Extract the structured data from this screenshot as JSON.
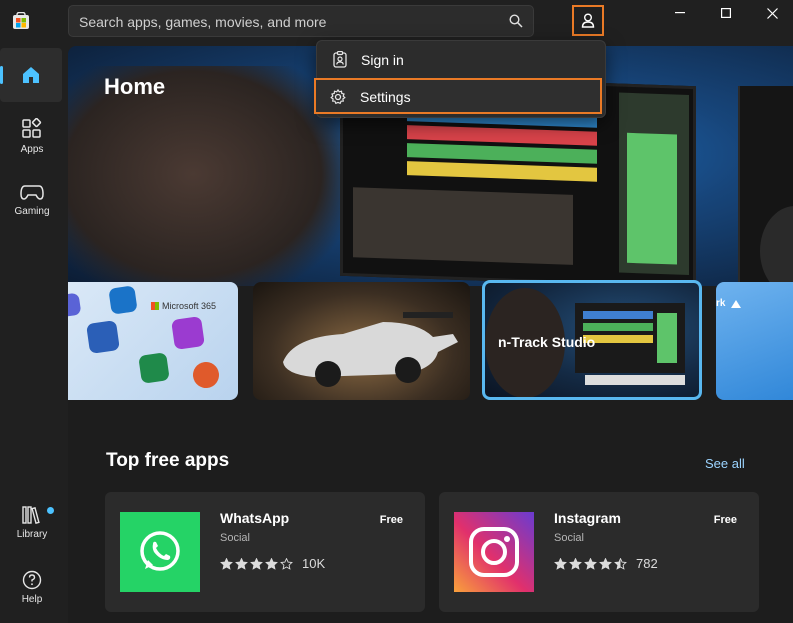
{
  "search": {
    "placeholder": "Search apps, games, movies, and more"
  },
  "sidebar": {
    "items": [
      {
        "label": ""
      },
      {
        "label": "Apps"
      },
      {
        "label": "Gaming"
      },
      {
        "label": "Library"
      },
      {
        "label": "Help"
      }
    ]
  },
  "hero": {
    "title": "Home"
  },
  "carousel": {
    "cards": [
      {
        "label": "Microsoft 365"
      },
      {
        "label": ""
      },
      {
        "label": "n-Track Studio"
      },
      {
        "label": "rk"
      }
    ]
  },
  "section": {
    "title": "Top free apps",
    "see_all": "See all"
  },
  "apps": [
    {
      "name": "WhatsApp",
      "category": "Social",
      "rating_count": "10K",
      "price": "Free",
      "stars": 4.0
    },
    {
      "name": "Instagram",
      "category": "Social",
      "rating_count": "782",
      "price": "Free",
      "stars": 4.5
    }
  ],
  "menu": {
    "items": [
      {
        "label": "Sign in"
      },
      {
        "label": "Settings"
      }
    ]
  },
  "colors": {
    "accent": "#4cc2ff",
    "highlight": "#ea7a26",
    "whatsapp": "#25d366"
  },
  "icons": [
    "store-logo-icon",
    "home-icon",
    "apps-icon",
    "gaming-icon",
    "library-icon",
    "help-icon",
    "search-icon",
    "account-icon",
    "minimize-icon",
    "maximize-icon",
    "close-icon",
    "profile-badge-icon",
    "gear-icon",
    "star-icon"
  ]
}
